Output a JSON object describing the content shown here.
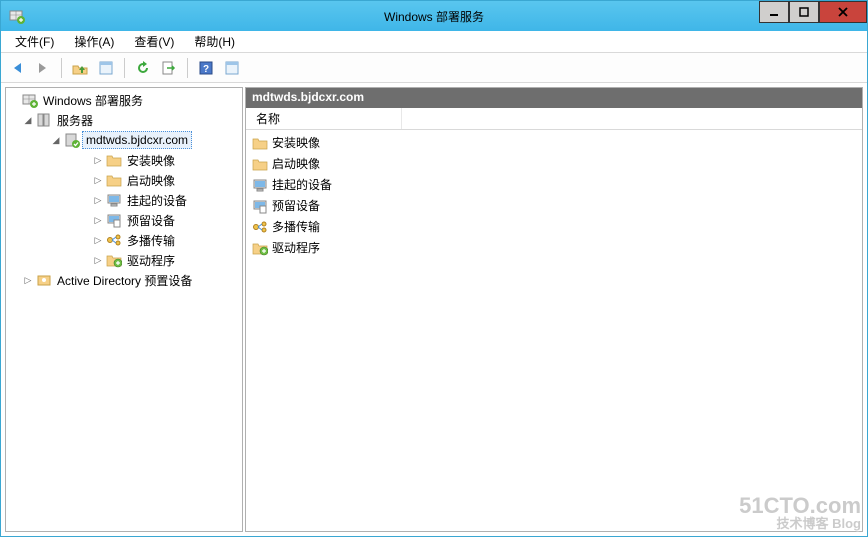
{
  "window": {
    "title": "Windows 部署服务"
  },
  "menus": {
    "file": "文件(F)",
    "action": "操作(A)",
    "view": "查看(V)",
    "help": "帮助(H)"
  },
  "tree": {
    "root": "Windows 部署服务",
    "servers": "服务器",
    "selected_server": "mdtwds.bjdcxr.com",
    "children": {
      "install_images": "安装映像",
      "boot_images": "启动映像",
      "pending_devices": "挂起的设备",
      "prestaged_devices": "预留设备",
      "multicast": "多播传输",
      "drivers": "驱动程序"
    },
    "ad_prestaged": "Active Directory 预置设备"
  },
  "list": {
    "header": "mdtwds.bjdcxr.com",
    "column_name": "名称",
    "rows": {
      "install_images": "安装映像",
      "boot_images": "启动映像",
      "pending_devices": "挂起的设备",
      "prestaged_devices": "预留设备",
      "multicast": "多播传输",
      "drivers": "驱动程序"
    }
  },
  "watermark": {
    "line1": "51CTO.com",
    "line2": "技术博客    Blog"
  }
}
